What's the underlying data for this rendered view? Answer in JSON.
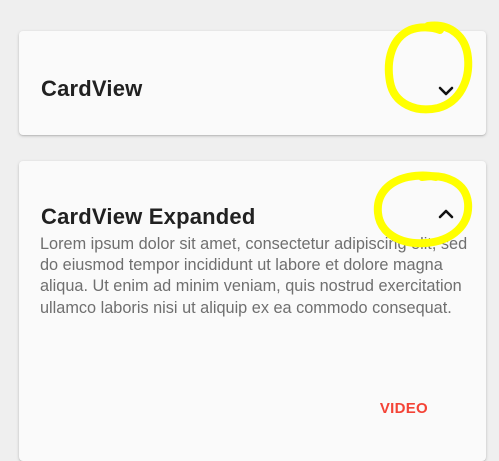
{
  "card_collapsed": {
    "title": "CardView",
    "toggle_icon": "chevron-down-icon"
  },
  "card_expanded": {
    "title": "CardView Expanded",
    "toggle_icon": "chevron-up-icon",
    "body": "Lorem ipsum dolor sit amet, consectetur adipiscing elit, sed do eiusmod tempor incididunt ut labore et dolore magna aliqua. Ut enim ad minim veniam, quis nostrud exercitation ullamco laboris nisi ut aliquip ex ea commodo consequat.",
    "action_label": "VIDEO"
  },
  "colors": {
    "background": "#efefef",
    "card": "#fafafa",
    "title_text": "#212121",
    "body_text": "#6f6f6f",
    "accent": "#f44336",
    "highlight": "#ffff00"
  }
}
